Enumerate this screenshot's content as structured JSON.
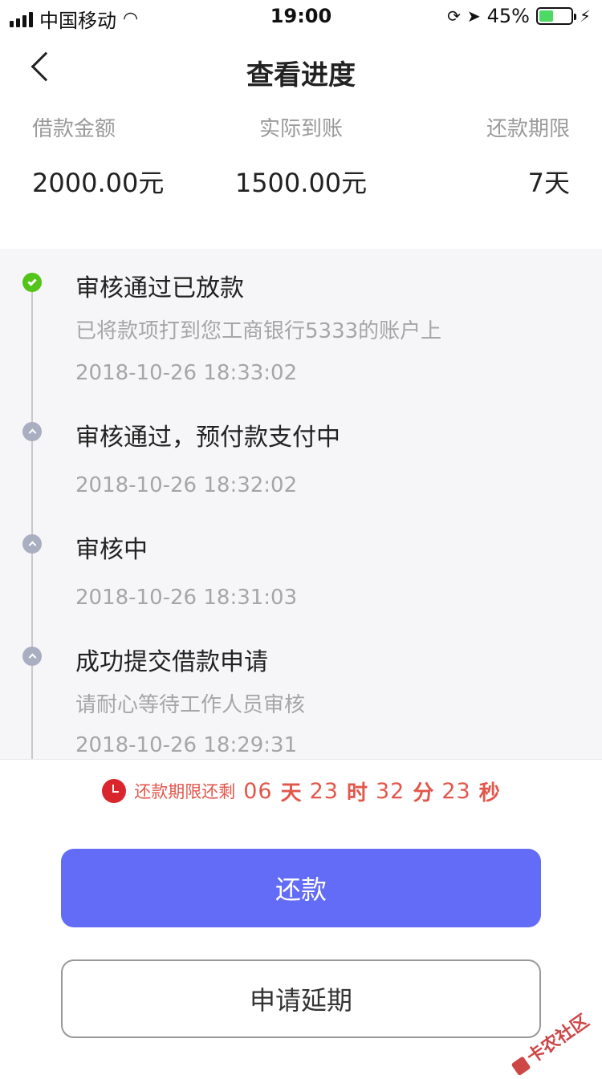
{
  "status_bar": {
    "carrier": "中国移动",
    "time": "19:00",
    "battery_percent": "45%",
    "battery_level": 0.45,
    "battery_color": "#4cd964"
  },
  "nav": {
    "title": "查看进度",
    "back_icon": "chevron-left-icon"
  },
  "summary": {
    "amount_label": "借款金额",
    "amount_value": "2000.00元",
    "received_label": "实际到账",
    "received_value": "1500.00元",
    "term_label": "还款期限",
    "term_value": "7天"
  },
  "timeline": [
    {
      "status": "done",
      "icon": "check-circle-icon",
      "title": "审核通过已放款",
      "desc": "已将款项打到您工商银行5333的账户上",
      "time": "2018-10-26 18:33:02"
    },
    {
      "status": "past",
      "icon": "caret-up-circle-icon",
      "title": "审核通过，预付款支付中",
      "desc": "",
      "time": "2018-10-26 18:32:02"
    },
    {
      "status": "past",
      "icon": "caret-up-circle-icon",
      "title": "审核中",
      "desc": "",
      "time": "2018-10-26 18:31:03"
    },
    {
      "status": "past",
      "icon": "caret-up-circle-icon",
      "title": "成功提交借款申请",
      "desc": "请耐心等待工作人员审核",
      "time": "2018-10-26 18:29:31"
    }
  ],
  "countdown": {
    "label": "还款期限还剩",
    "days": "06",
    "days_unit": "天",
    "hours": "23",
    "hours_unit": "时",
    "minutes": "32",
    "minutes_unit": "分",
    "seconds": "23",
    "seconds_unit": "秒",
    "color": "#e2574c"
  },
  "buttons": {
    "repay": "还款",
    "extend": "申请延期",
    "primary_color": "#636cf6"
  },
  "watermark": {
    "text": "卡农社区"
  }
}
